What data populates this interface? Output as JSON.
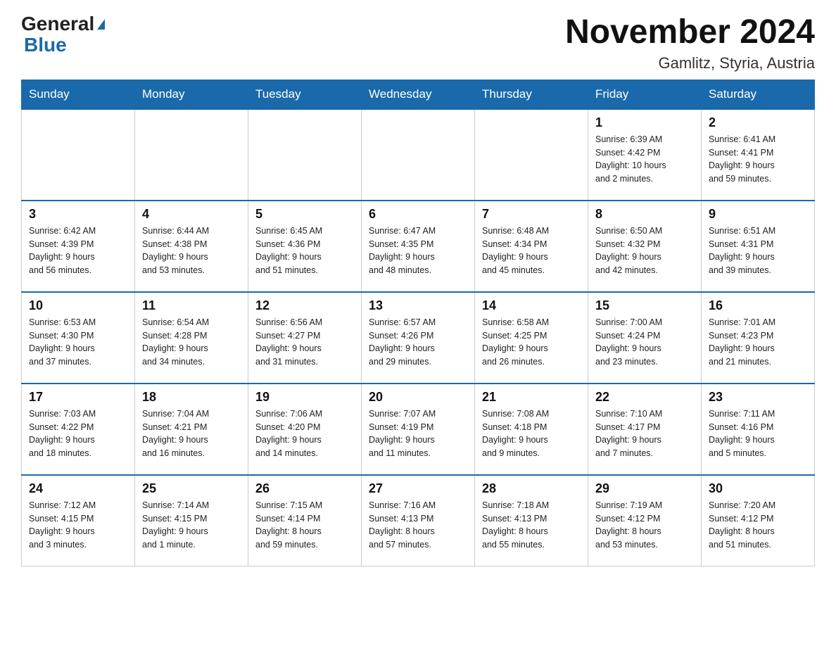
{
  "header": {
    "logo_general": "General",
    "logo_blue": "Blue",
    "month_title": "November 2024",
    "location": "Gamlitz, Styria, Austria"
  },
  "weekdays": [
    "Sunday",
    "Monday",
    "Tuesday",
    "Wednesday",
    "Thursday",
    "Friday",
    "Saturday"
  ],
  "weeks": [
    [
      {
        "day": "",
        "info": ""
      },
      {
        "day": "",
        "info": ""
      },
      {
        "day": "",
        "info": ""
      },
      {
        "day": "",
        "info": ""
      },
      {
        "day": "",
        "info": ""
      },
      {
        "day": "1",
        "info": "Sunrise: 6:39 AM\nSunset: 4:42 PM\nDaylight: 10 hours\nand 2 minutes."
      },
      {
        "day": "2",
        "info": "Sunrise: 6:41 AM\nSunset: 4:41 PM\nDaylight: 9 hours\nand 59 minutes."
      }
    ],
    [
      {
        "day": "3",
        "info": "Sunrise: 6:42 AM\nSunset: 4:39 PM\nDaylight: 9 hours\nand 56 minutes."
      },
      {
        "day": "4",
        "info": "Sunrise: 6:44 AM\nSunset: 4:38 PM\nDaylight: 9 hours\nand 53 minutes."
      },
      {
        "day": "5",
        "info": "Sunrise: 6:45 AM\nSunset: 4:36 PM\nDaylight: 9 hours\nand 51 minutes."
      },
      {
        "day": "6",
        "info": "Sunrise: 6:47 AM\nSunset: 4:35 PM\nDaylight: 9 hours\nand 48 minutes."
      },
      {
        "day": "7",
        "info": "Sunrise: 6:48 AM\nSunset: 4:34 PM\nDaylight: 9 hours\nand 45 minutes."
      },
      {
        "day": "8",
        "info": "Sunrise: 6:50 AM\nSunset: 4:32 PM\nDaylight: 9 hours\nand 42 minutes."
      },
      {
        "day": "9",
        "info": "Sunrise: 6:51 AM\nSunset: 4:31 PM\nDaylight: 9 hours\nand 39 minutes."
      }
    ],
    [
      {
        "day": "10",
        "info": "Sunrise: 6:53 AM\nSunset: 4:30 PM\nDaylight: 9 hours\nand 37 minutes."
      },
      {
        "day": "11",
        "info": "Sunrise: 6:54 AM\nSunset: 4:28 PM\nDaylight: 9 hours\nand 34 minutes."
      },
      {
        "day": "12",
        "info": "Sunrise: 6:56 AM\nSunset: 4:27 PM\nDaylight: 9 hours\nand 31 minutes."
      },
      {
        "day": "13",
        "info": "Sunrise: 6:57 AM\nSunset: 4:26 PM\nDaylight: 9 hours\nand 29 minutes."
      },
      {
        "day": "14",
        "info": "Sunrise: 6:58 AM\nSunset: 4:25 PM\nDaylight: 9 hours\nand 26 minutes."
      },
      {
        "day": "15",
        "info": "Sunrise: 7:00 AM\nSunset: 4:24 PM\nDaylight: 9 hours\nand 23 minutes."
      },
      {
        "day": "16",
        "info": "Sunrise: 7:01 AM\nSunset: 4:23 PM\nDaylight: 9 hours\nand 21 minutes."
      }
    ],
    [
      {
        "day": "17",
        "info": "Sunrise: 7:03 AM\nSunset: 4:22 PM\nDaylight: 9 hours\nand 18 minutes."
      },
      {
        "day": "18",
        "info": "Sunrise: 7:04 AM\nSunset: 4:21 PM\nDaylight: 9 hours\nand 16 minutes."
      },
      {
        "day": "19",
        "info": "Sunrise: 7:06 AM\nSunset: 4:20 PM\nDaylight: 9 hours\nand 14 minutes."
      },
      {
        "day": "20",
        "info": "Sunrise: 7:07 AM\nSunset: 4:19 PM\nDaylight: 9 hours\nand 11 minutes."
      },
      {
        "day": "21",
        "info": "Sunrise: 7:08 AM\nSunset: 4:18 PM\nDaylight: 9 hours\nand 9 minutes."
      },
      {
        "day": "22",
        "info": "Sunrise: 7:10 AM\nSunset: 4:17 PM\nDaylight: 9 hours\nand 7 minutes."
      },
      {
        "day": "23",
        "info": "Sunrise: 7:11 AM\nSunset: 4:16 PM\nDaylight: 9 hours\nand 5 minutes."
      }
    ],
    [
      {
        "day": "24",
        "info": "Sunrise: 7:12 AM\nSunset: 4:15 PM\nDaylight: 9 hours\nand 3 minutes."
      },
      {
        "day": "25",
        "info": "Sunrise: 7:14 AM\nSunset: 4:15 PM\nDaylight: 9 hours\nand 1 minute."
      },
      {
        "day": "26",
        "info": "Sunrise: 7:15 AM\nSunset: 4:14 PM\nDaylight: 8 hours\nand 59 minutes."
      },
      {
        "day": "27",
        "info": "Sunrise: 7:16 AM\nSunset: 4:13 PM\nDaylight: 8 hours\nand 57 minutes."
      },
      {
        "day": "28",
        "info": "Sunrise: 7:18 AM\nSunset: 4:13 PM\nDaylight: 8 hours\nand 55 minutes."
      },
      {
        "day": "29",
        "info": "Sunrise: 7:19 AM\nSunset: 4:12 PM\nDaylight: 8 hours\nand 53 minutes."
      },
      {
        "day": "30",
        "info": "Sunrise: 7:20 AM\nSunset: 4:12 PM\nDaylight: 8 hours\nand 51 minutes."
      }
    ]
  ]
}
